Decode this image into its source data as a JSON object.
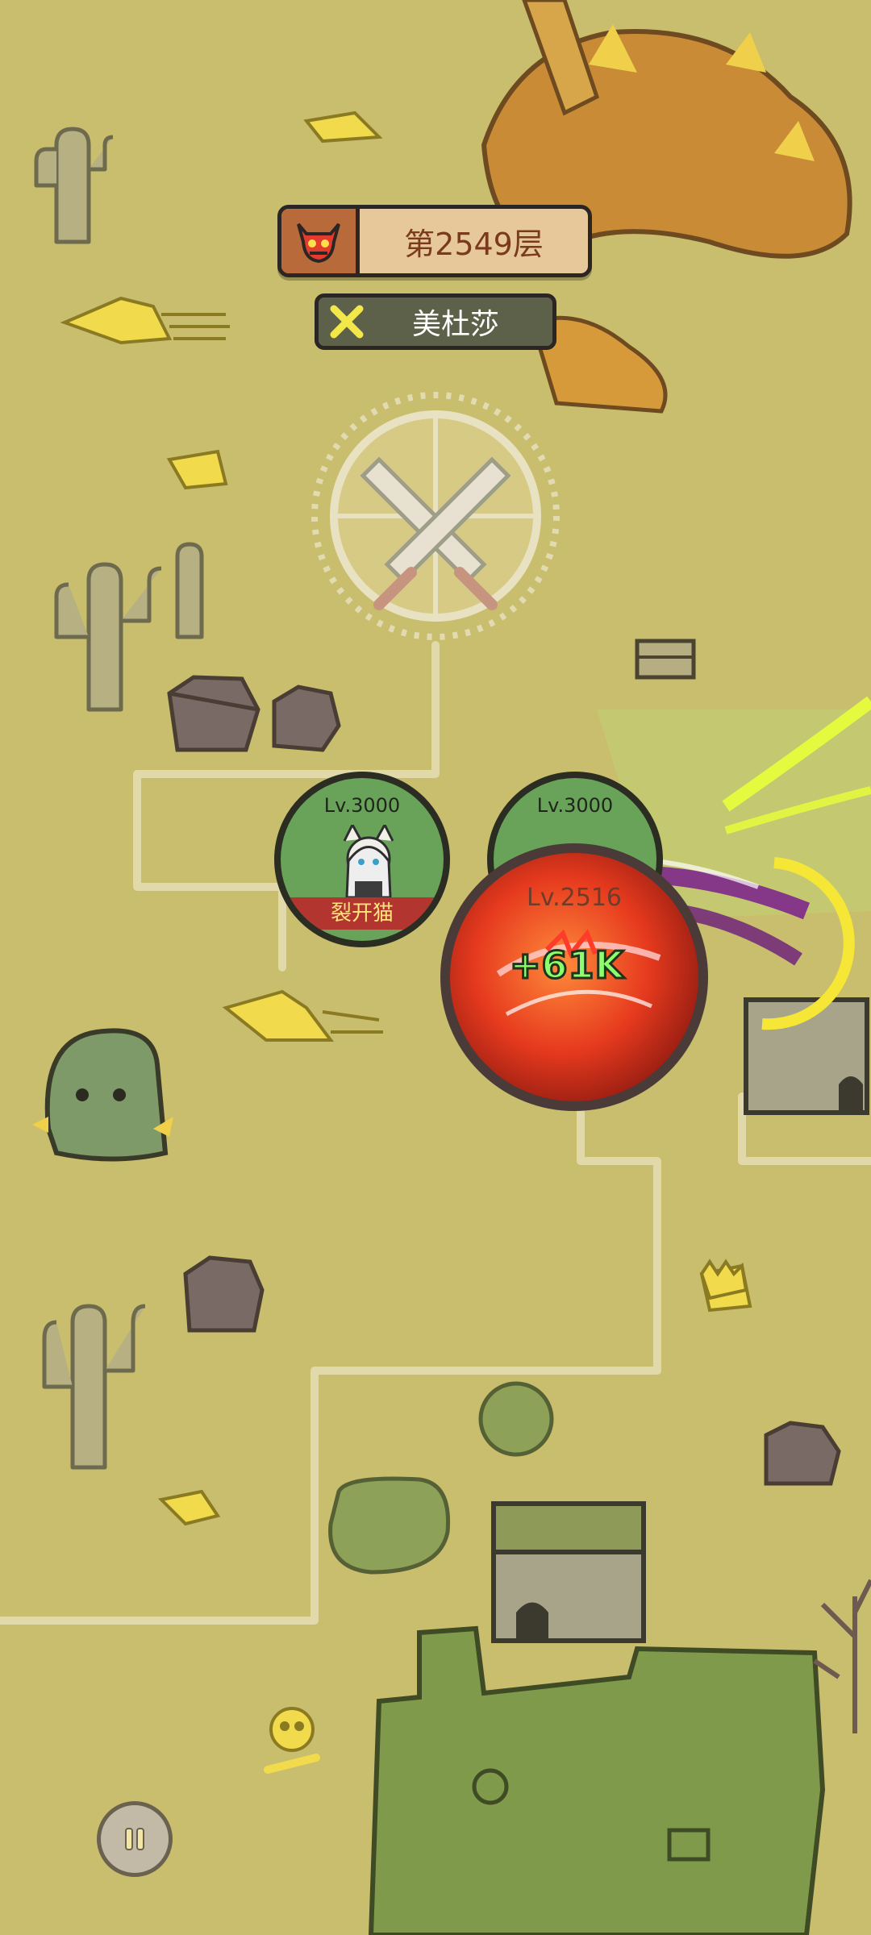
{
  "hud": {
    "floor_label": "第2549层",
    "enemy_name": "美杜莎"
  },
  "heroes": [
    {
      "level": "Lv.3000",
      "name": "裂开猫"
    },
    {
      "level": "Lv.3000",
      "name": ""
    }
  ],
  "boss": {
    "level": "Lv.2516"
  },
  "damage_popup": "+61K",
  "controls": {
    "pause_icon": "pause-icon"
  },
  "colors": {
    "map_bg": "#c9bd6e",
    "hero_ring": "#69a35a",
    "boss_red": "#e63a1e",
    "damage_green": "#8dff6e"
  }
}
